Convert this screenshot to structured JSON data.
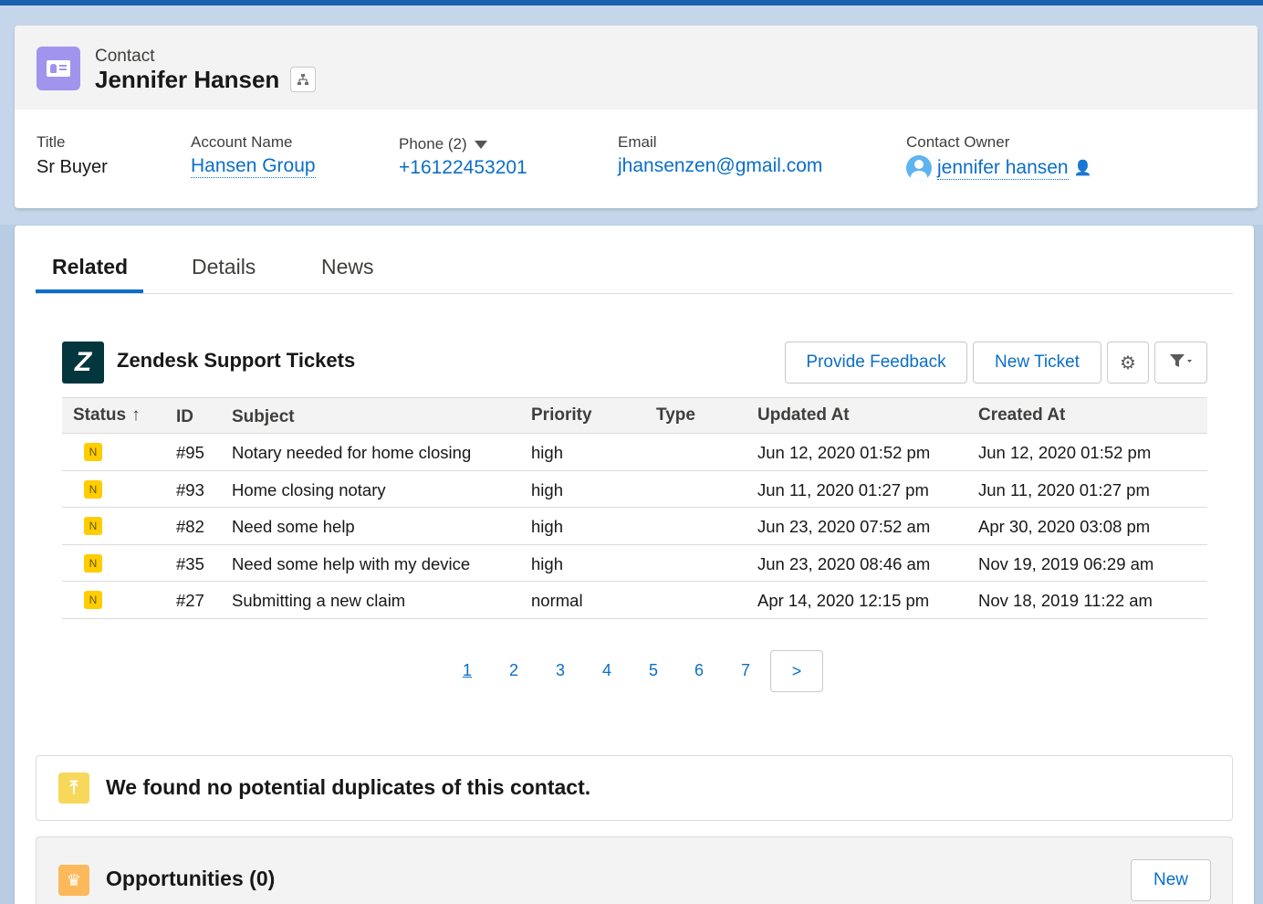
{
  "header": {
    "record_type": "Contact",
    "record_name": "Jennifer Hansen",
    "icons": {
      "record": "contact-card-icon",
      "hierarchy": "hierarchy-icon"
    }
  },
  "fields": {
    "title": {
      "label": "Title",
      "value": "Sr Buyer"
    },
    "account": {
      "label": "Account Name",
      "value": "Hansen Group"
    },
    "phone": {
      "label": "Phone (2)",
      "value": "+16122453201"
    },
    "email": {
      "label": "Email",
      "value": "jhansenzen@gmail.com"
    },
    "owner": {
      "label": "Contact Owner",
      "value": "jennifer hansen"
    }
  },
  "tabs": [
    {
      "label": "Related",
      "active": true
    },
    {
      "label": "Details",
      "active": false
    },
    {
      "label": "News",
      "active": false
    }
  ],
  "zendesk": {
    "title": "Zendesk Support Tickets",
    "logo_text": "Z",
    "buttons": {
      "feedback": "Provide Feedback",
      "new_ticket": "New Ticket",
      "settings_icon": "gear-icon",
      "filter_icon": "filter-icon"
    },
    "columns": [
      "Status",
      "ID",
      "Subject",
      "Priority",
      "Type",
      "Updated At",
      "Created At"
    ],
    "sort_indicator": "↑",
    "rows": [
      {
        "status": "N",
        "id": "#95",
        "subject": "Notary needed for home closing",
        "priority": "high",
        "type": "",
        "updated": "Jun 12, 2020 01:52 pm",
        "created": "Jun 12, 2020 01:52 pm"
      },
      {
        "status": "N",
        "id": "#93",
        "subject": "Home closing notary",
        "priority": "high",
        "type": "",
        "updated": "Jun 11, 2020 01:27 pm",
        "created": "Jun 11, 2020 01:27 pm"
      },
      {
        "status": "N",
        "id": "#82",
        "subject": "Need some help",
        "priority": "high",
        "type": "",
        "updated": "Jun 23, 2020 07:52 am",
        "created": "Apr 30, 2020 03:08 pm"
      },
      {
        "status": "N",
        "id": "#35",
        "subject": "Need some help with my device",
        "priority": "high",
        "type": "",
        "updated": "Jun 23, 2020 08:46 am",
        "created": "Nov 19, 2019 06:29 am"
      },
      {
        "status": "N",
        "id": "#27",
        "subject": "Submitting a new claim",
        "priority": "normal",
        "type": "",
        "updated": "Apr 14, 2020 12:15 pm",
        "created": "Nov 18, 2019 11:22 am"
      }
    ],
    "pagination": {
      "pages": [
        "1",
        "2",
        "3",
        "4",
        "5",
        "6",
        "7"
      ],
      "current": "1",
      "next": ">"
    }
  },
  "duplicates": {
    "message": "We found no potential duplicates of this contact.",
    "icon": "merge-icon"
  },
  "opportunities": {
    "title": "Opportunities (0)",
    "new_label": "New",
    "icon": "crown-icon"
  },
  "colors": {
    "brand_blue": "#0b6ec9",
    "status_new": "#ffcd00",
    "contact_icon": "#a094ed",
    "zendesk": "#03363d"
  }
}
